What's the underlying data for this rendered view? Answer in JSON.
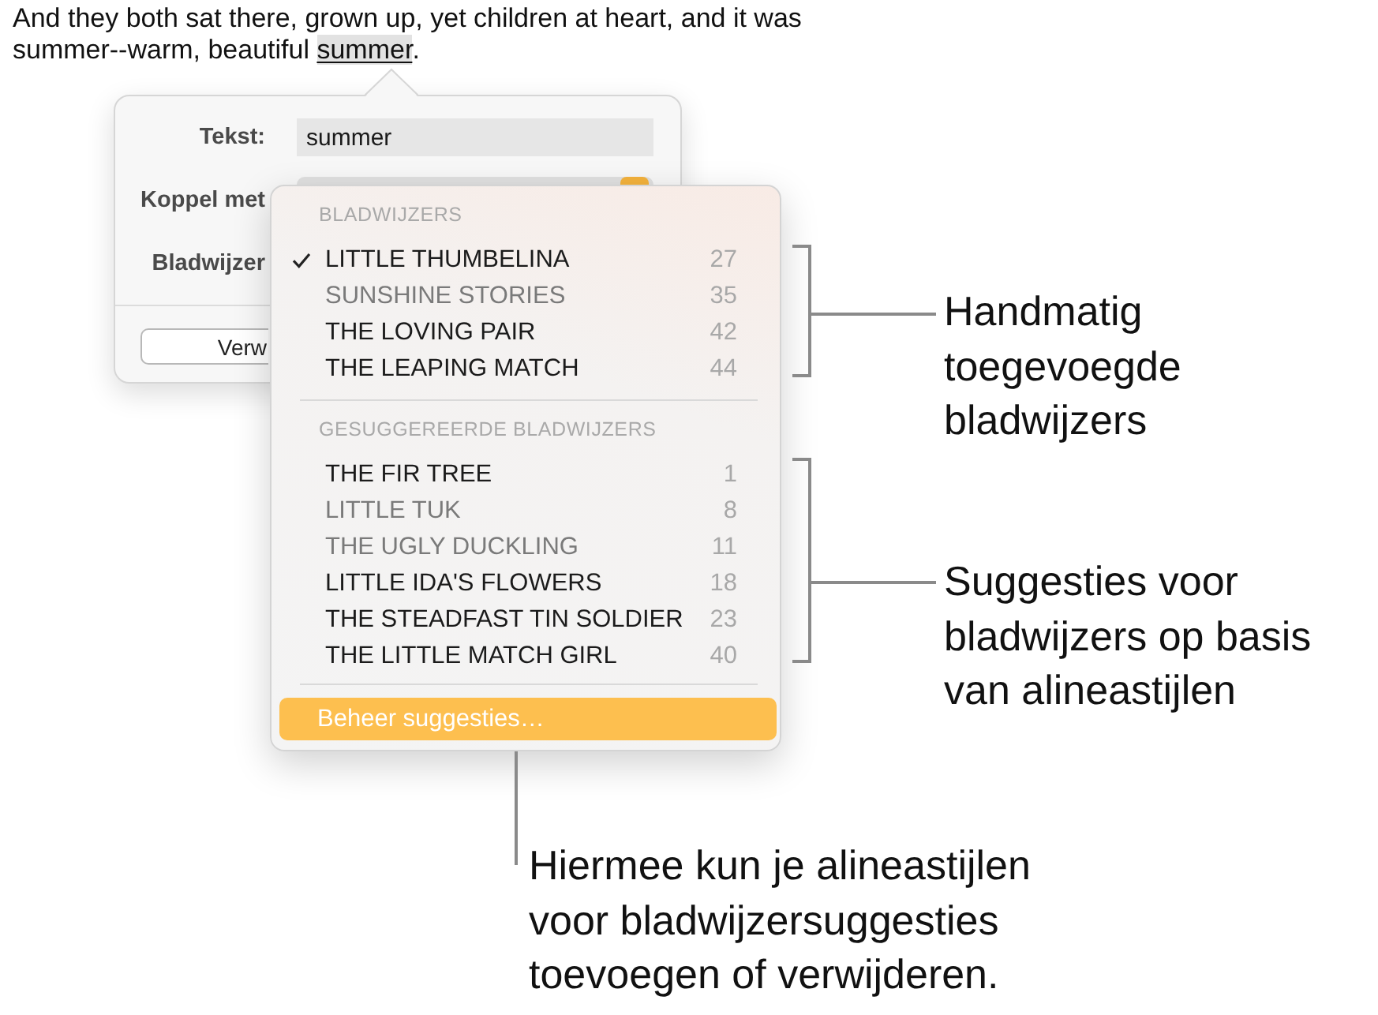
{
  "paragraph": {
    "text": "And they both sat there, grown up, yet children at heart, and it was summer--warm, beautiful ",
    "highlight": "summer",
    "end": "."
  },
  "popover": {
    "fields": [
      {
        "label": "Tekst:",
        "kind": "text",
        "value": "summer"
      },
      {
        "label": "Koppel met",
        "kind": "select"
      },
      {
        "label": "Bladwijzer",
        "kind": "hidden"
      }
    ],
    "button": "Verw"
  },
  "menu": {
    "sections": [
      {
        "header": "BLADWIJZERS",
        "items": [
          {
            "label": "LITTLE THUMBELINA",
            "page": "27",
            "checked": true,
            "dimmed": false
          },
          {
            "label": "SUNSHINE STORIES",
            "page": "35",
            "checked": false,
            "dimmed": true
          },
          {
            "label": "THE LOVING PAIR",
            "page": "42",
            "checked": false,
            "dimmed": false
          },
          {
            "label": "THE LEAPING MATCH",
            "page": "44",
            "checked": false,
            "dimmed": false
          }
        ]
      },
      {
        "header": "GESUGGEREERDE BLADWIJZERS",
        "items": [
          {
            "label": "THE FIR TREE",
            "page": "1",
            "checked": false,
            "dimmed": false
          },
          {
            "label": "LITTLE TUK",
            "page": "8",
            "checked": false,
            "dimmed": true
          },
          {
            "label": "THE UGLY DUCKLING",
            "page": "11",
            "checked": false,
            "dimmed": true
          },
          {
            "label": "LITTLE IDA'S FLOWERS",
            "page": "18",
            "checked": false,
            "dimmed": false
          },
          {
            "label": "THE STEADFAST TIN SOLDIER",
            "page": "23",
            "checked": false,
            "dimmed": false
          },
          {
            "label": "THE LITTLE MATCH GIRL",
            "page": "40",
            "checked": false,
            "dimmed": false
          }
        ]
      }
    ],
    "action": {
      "label": "Beheer suggesties…",
      "selected": true
    }
  },
  "callouts": [
    {
      "kind": "bracket",
      "text": "Handmatig toegevoegde bladwijzers"
    },
    {
      "kind": "bracket",
      "text": "Suggesties voor bladwijzers op basis van alineastijlen"
    },
    {
      "kind": "line",
      "text": "Hiermee kun je alineastijlen voor bladwijzersuggesties toevoegen of verwijderen."
    }
  ]
}
